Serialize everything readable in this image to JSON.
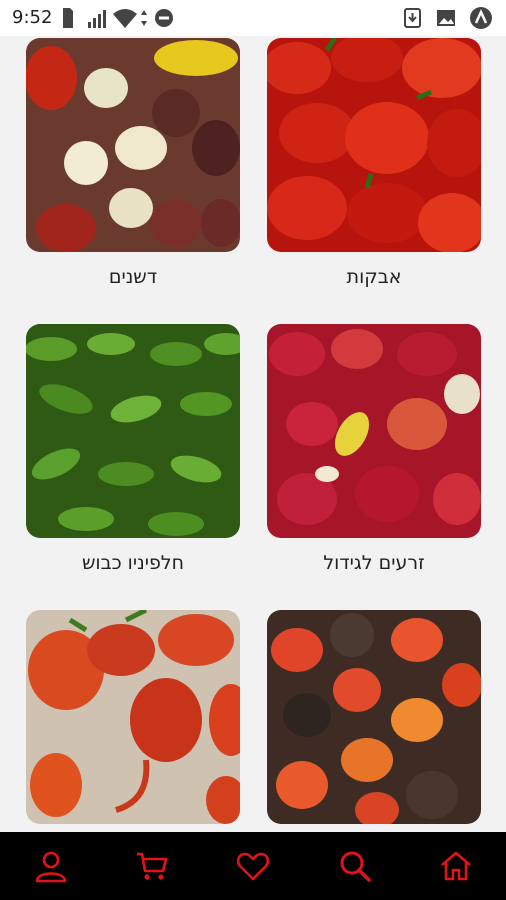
{
  "status_bar": {
    "time": "9:52",
    "icons": [
      "sd-card-icon",
      "signal-icon",
      "wifi-icon",
      "do-not-disturb-icon",
      "download-icon",
      "image-icon",
      "app-icon"
    ]
  },
  "categories": [
    {
      "label": "אבקות",
      "image": "red-peppers-photo"
    },
    {
      "label": "דשנים",
      "image": "mixed-peppers-photo"
    },
    {
      "label": "זרעים לגידול",
      "image": "red-yellow-peppers-photo"
    },
    {
      "label": "חלפיניו כבוש",
      "image": "green-jalapenos-photo"
    },
    {
      "label": "",
      "image": "orange-chocolate-peppers-photo"
    },
    {
      "label": "",
      "image": "reaper-peppers-photo"
    }
  ],
  "bottom_nav": {
    "items": [
      "home-icon",
      "search-icon",
      "heart-icon",
      "cart-icon",
      "user-icon"
    ],
    "accent": "#e0121a",
    "background": "#000000"
  }
}
